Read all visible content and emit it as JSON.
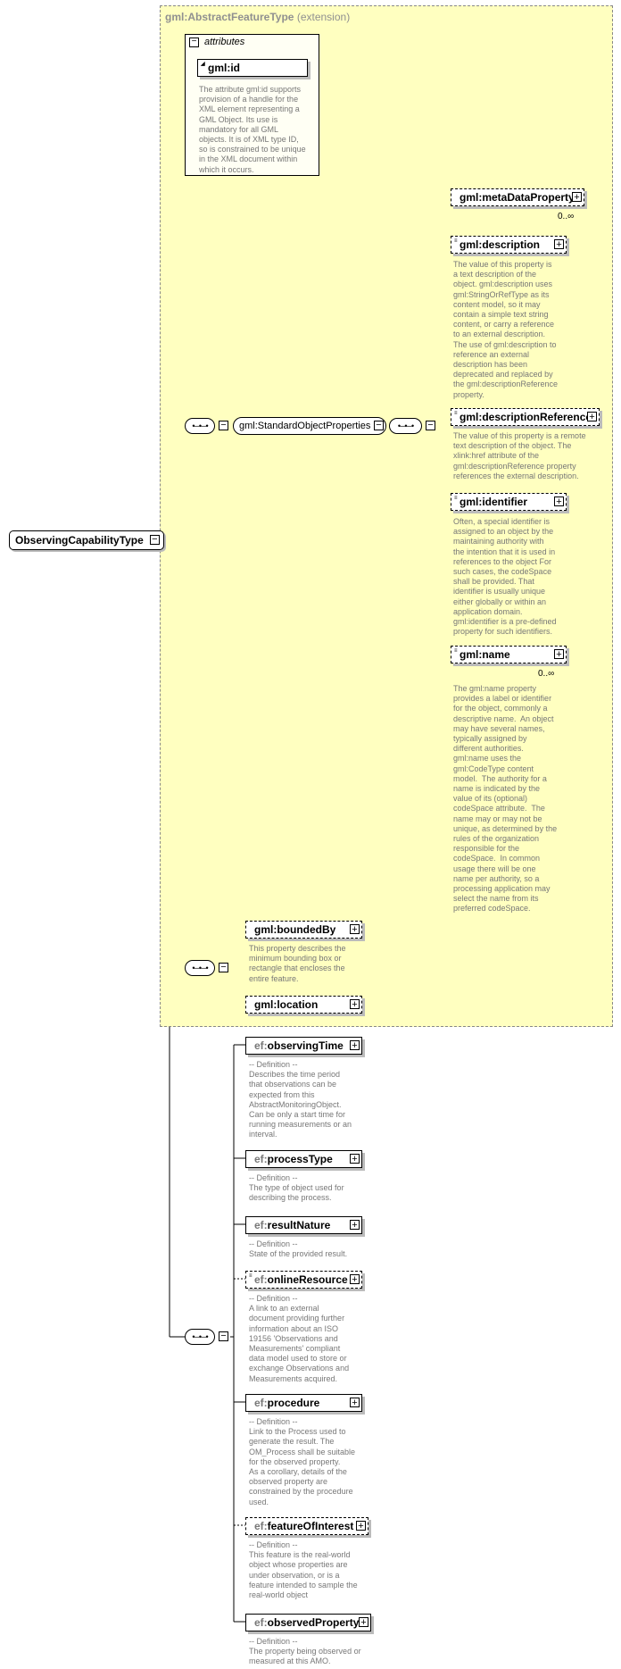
{
  "root_element": "ObservingCapabilityType",
  "extension": {
    "type": "gml:AbstractFeatureType",
    "suffix": "(extension)"
  },
  "attributes": {
    "title": "attributes",
    "item": "gml:id",
    "description": "The attribute gml:id supports\nprovision of a handle for the\nXML element representing a\nGML Object. Its use is\nmandatory for all GML\nobjects. It is of XML type ID,\nso is constrained to be unique\nin the XML document within\nwhich it occurs."
  },
  "group": {
    "name": "gml:StandardObjectProperties"
  },
  "standard_elements": [
    {
      "name": "gml:metaDataProperty",
      "occurrence": "0..∞",
      "description": ""
    },
    {
      "name": "gml:description",
      "occurrence": "",
      "description": "The value of this property is\na text description of the\nobject. gml:description uses\ngml:StringOrRefType as its\ncontent model, so it may\ncontain a simple text string\ncontent, or carry a reference\nto an external description.\nThe use of gml:description to\nreference an external\ndescription has been\ndeprecated and replaced by\nthe gml:descriptionReference\nproperty."
    },
    {
      "name": "gml:descriptionReference",
      "occurrence": "",
      "description": "The value of this property is a remote\ntext description of the object. The\nxlink:href attribute of the\ngml:descriptionReference property\nreferences the external description."
    },
    {
      "name": "gml:identifier",
      "occurrence": "",
      "description": "Often, a special identifier is\nassigned to an object by the\nmaintaining authority with\nthe intention that it is used in\nreferences to the object For\nsuch cases, the codeSpace\nshall be provided. That\nidentifier is usually unique\neither globally or within an\napplication domain.\ngml:identifier is a pre-defined\nproperty for such identifiers."
    },
    {
      "name": "gml:name",
      "occurrence": "0..∞",
      "description": "The gml:name property\nprovides a label or identifier\nfor the object, commonly a\ndescriptive name.  An object\nmay have several names,\ntypically assigned by\ndifferent authorities.\ngml:name uses the\ngml:CodeType content\nmodel.  The authority for a\nname is indicated by the\nvalue of its (optional)\ncodeSpace attribute.  The\nname may or may not be\nunique, as determined by the\nrules of the organization\nresponsible for the\ncodeSpace.  In common\nusage there will be one\nname per authority, so a\nprocessing application may\nselect the name from its\npreferred codeSpace."
    }
  ],
  "feature_elements": [
    {
      "name": "gml:boundedBy",
      "description": "This property describes the\nminimum bounding box or\nrectangle that encloses the\nentire feature."
    },
    {
      "name": "gml:location",
      "description": ""
    }
  ],
  "ef_elements": [
    {
      "prefix": "ef:",
      "name": "observingTime",
      "description": "-- Definition --\nDescribes the time period\nthat observations can be\nexpected from this\nAbstractMonitoringObject.\nCan be only a start time for\nrunning measurements or an\ninterval."
    },
    {
      "prefix": "ef:",
      "name": "processType",
      "description": "-- Definition --\nThe type of object used for\ndescribing the process."
    },
    {
      "prefix": "ef:",
      "name": "resultNature",
      "description": "-- Definition --\nState of the provided result."
    },
    {
      "prefix": "ef:",
      "name": "onlineResource",
      "description": "-- Definition --\nA link to an external\ndocument providing further\ninformation about an ISO\n19156 'Observations and\nMeasurements' compliant\ndata model used to store or\nexchange Observations and\nMeasurements acquired."
    },
    {
      "prefix": "ef:",
      "name": "procedure",
      "description": "-- Definition --\nLink to the Process used to\ngenerate the result. The\nOM_Process shall be suitable\nfor the observed property.\nAs a corollary, details of the\nobserved property are\nconstrained by the procedure\nused."
    },
    {
      "prefix": "ef:",
      "name": "featureOfInterest",
      "description": "-- Definition --\nThis feature is the real-world\nobject whose properties are\nunder observation, or is a\nfeature intended to sample the\nreal-world object"
    },
    {
      "prefix": "ef:",
      "name": "observedProperty",
      "description": "-- Definition --\nThe property being observed or\nmeasured at this AMO."
    }
  ]
}
